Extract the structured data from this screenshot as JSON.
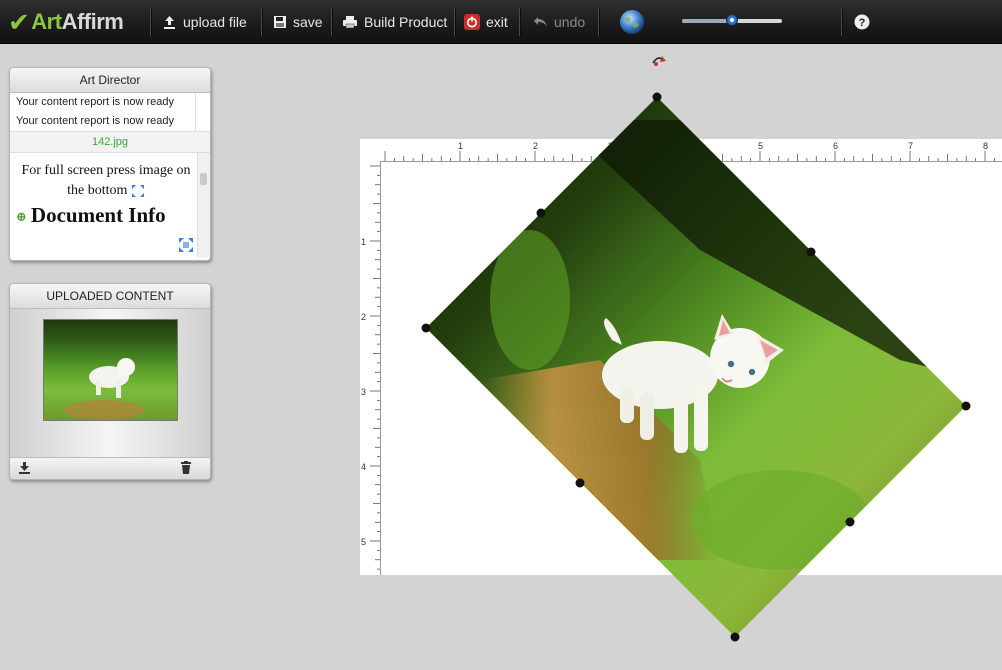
{
  "toolbar": {
    "logo": {
      "part1": "Art",
      "part2": "Affirm"
    },
    "upload": "upload file",
    "save": "save",
    "build": "Build Product",
    "exit": "exit",
    "undo": "undo",
    "zoom_level": 0.5
  },
  "art_director": {
    "title": "Art Director",
    "reports": [
      "Your content report is now ready",
      "Your content report is now ready"
    ],
    "filename": "142.jpg",
    "hint": "For full screen press image on the bottom",
    "doc_info": "Document Info"
  },
  "uploaded": {
    "title": "UPLOADED CONTENT"
  },
  "ruler": {
    "top_labels": [
      "1",
      "2",
      "3",
      "4",
      "5",
      "6",
      "7",
      "8"
    ],
    "left_labels": [
      "1",
      "2",
      "3",
      "4",
      "5"
    ]
  },
  "colors": {
    "accent_green": "#8cc63f",
    "filename_green": "#3aa535"
  }
}
